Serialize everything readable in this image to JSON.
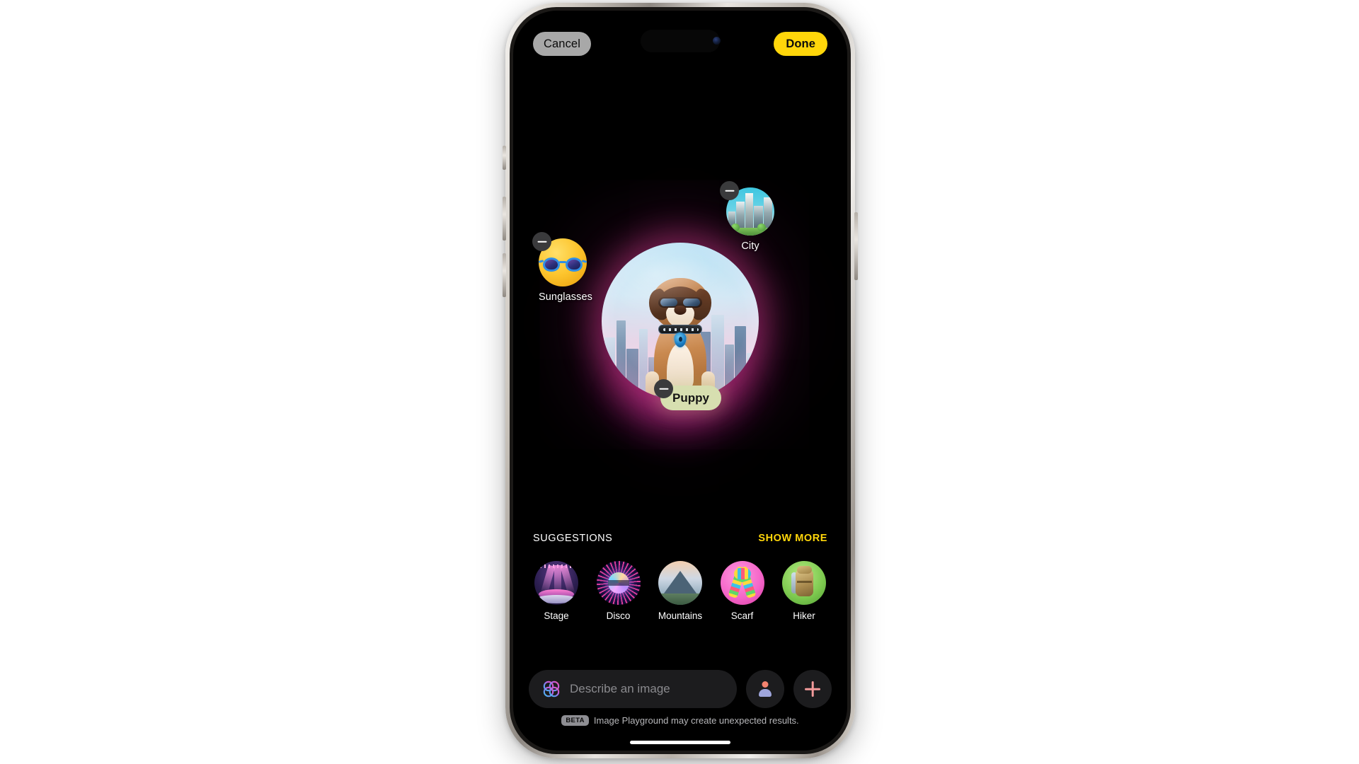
{
  "app": {
    "name": "Image Playground",
    "accent_yellow": "#FFD60A",
    "background": "#000000"
  },
  "navbar": {
    "cancel_label": "Cancel",
    "done_label": "Done"
  },
  "canvas": {
    "main_image_alt": "Puppy wearing sunglasses in a city",
    "concepts": [
      {
        "id": "sunglasses",
        "label": "Sunglasses",
        "type": "thumbnail",
        "remove_label": "Remove"
      },
      {
        "id": "city",
        "label": "City",
        "type": "thumbnail",
        "remove_label": "Remove"
      },
      {
        "id": "puppy",
        "label": "Puppy",
        "type": "pill",
        "remove_label": "Remove"
      }
    ]
  },
  "suggestions": {
    "title": "SUGGESTIONS",
    "show_more_label": "SHOW MORE",
    "items": [
      {
        "id": "stage",
        "label": "Stage"
      },
      {
        "id": "disco",
        "label": "Disco"
      },
      {
        "id": "mountains",
        "label": "Mountains"
      },
      {
        "id": "scarf",
        "label": "Scarf"
      },
      {
        "id": "hiker",
        "label": "Hiker"
      }
    ]
  },
  "composer": {
    "input_value": "",
    "input_placeholder": "Describe an image",
    "person_button_label": "Choose a person",
    "add_button_label": "Add"
  },
  "footer": {
    "beta_badge": "BETA",
    "disclaimer": "Image Playground may create unexpected results."
  }
}
